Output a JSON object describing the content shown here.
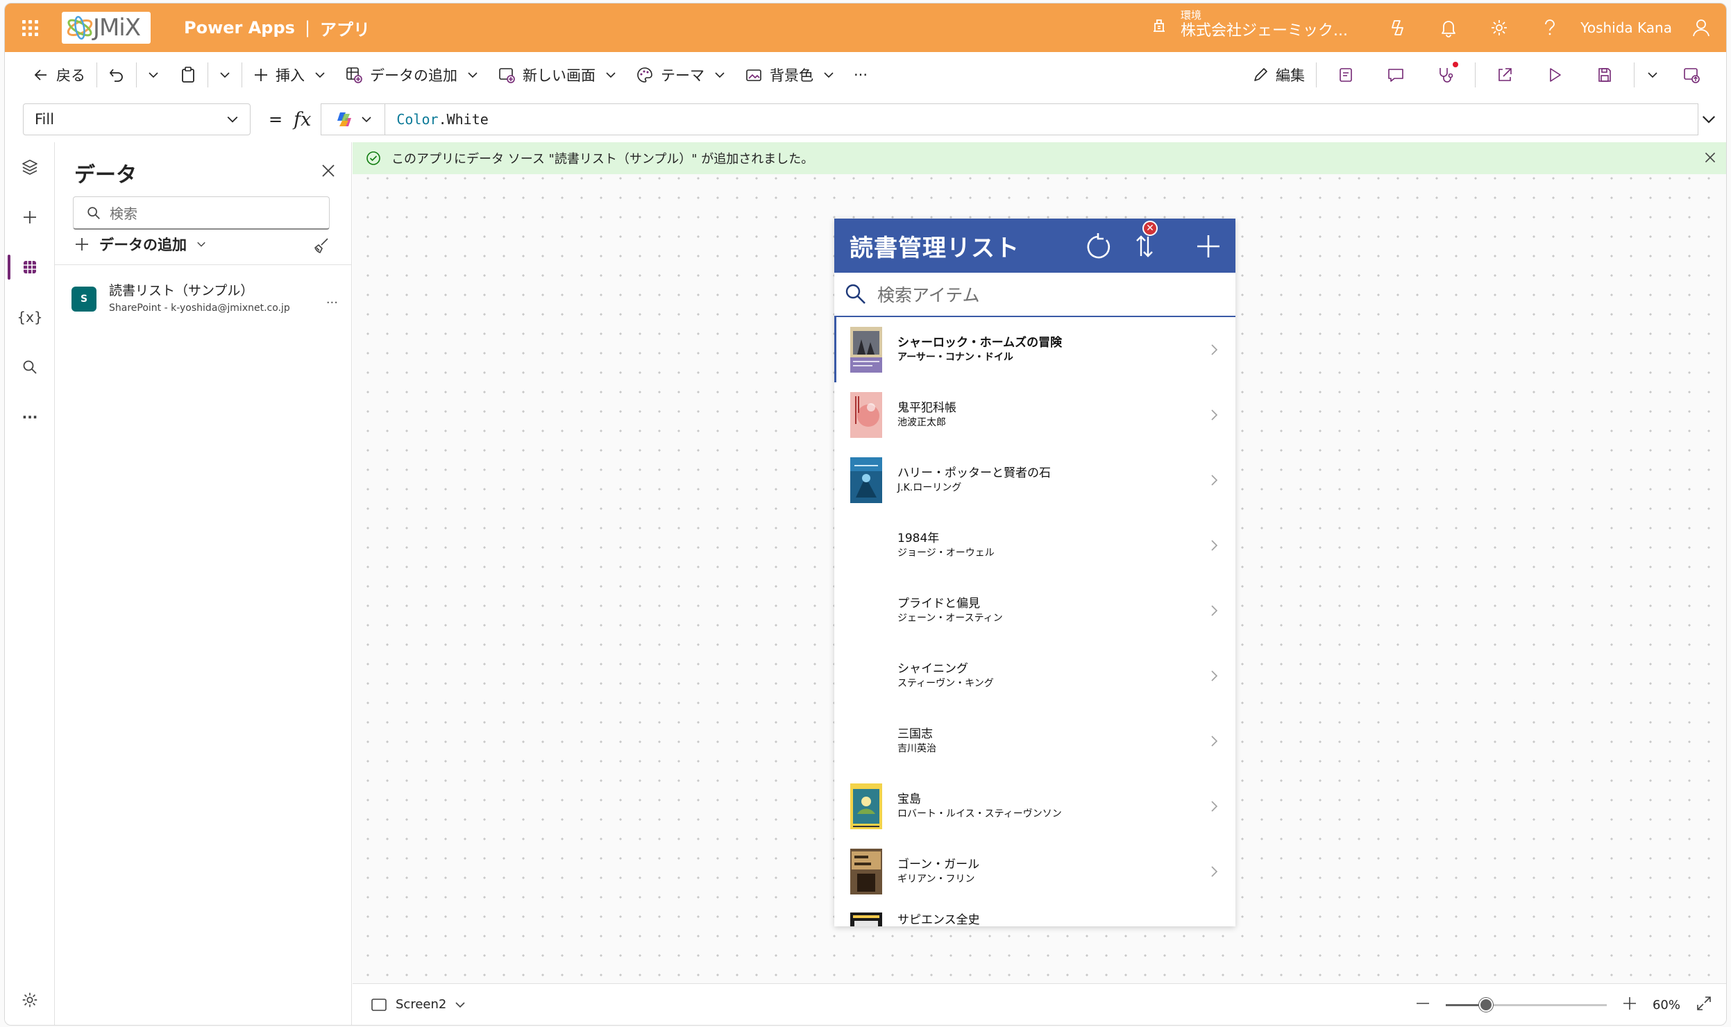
{
  "header": {
    "brand": "JMiX",
    "product": "Power Apps",
    "separator": "|",
    "section": "アプリ",
    "env_label": "環境",
    "env_name": "株式会社ジェーミック...",
    "user_name": "Yoshida Kana",
    "bg_color": "#f5a04a"
  },
  "commandbar": {
    "back": "戻る",
    "insert": "挿入",
    "add_data": "データの追加",
    "new_screen": "新しい画面",
    "theme": "テーマ",
    "background": "背景色",
    "more": "···",
    "edit": "編集"
  },
  "formula": {
    "property": "Fill",
    "equals": "=",
    "fx": "fx",
    "ns": "Color",
    "value": ".White"
  },
  "rail": {
    "variables": "{x}",
    "more": "···"
  },
  "data_panel": {
    "title": "データ",
    "search_placeholder": "検索",
    "add_data": "データの追加",
    "sources": [
      {
        "name": "読書リスト（サンプル）",
        "sub": "SharePoint - k-yoshida@jmixnet.co.jp",
        "more": "..."
      }
    ]
  },
  "banner": {
    "message": "このアプリにデータ ソース \"読書リスト（サンプル）\" が追加されました。"
  },
  "app": {
    "title": "読書管理リスト",
    "search_placeholder": "検索アイテム",
    "error_badge": "✕",
    "accent": "#3a5aa6",
    "items": [
      {
        "title": "シャーロック・ホームズの冒険",
        "author": "アーサー・コナン・ドイル",
        "cover": "sherlock"
      },
      {
        "title": "鬼平犯科帳",
        "author": "池波正太郎",
        "cover": "onihei"
      },
      {
        "title": "ハリー・ポッターと賢者の石",
        "author": "J.K.ローリング",
        "cover": "harry"
      },
      {
        "title": "1984年",
        "author": "ジョージ・オーウェル",
        "cover": ""
      },
      {
        "title": "プライドと偏見",
        "author": "ジェーン・オースティン",
        "cover": ""
      },
      {
        "title": "シャイニング",
        "author": "スティーヴン・キング",
        "cover": ""
      },
      {
        "title": "三国志",
        "author": "吉川英治",
        "cover": ""
      },
      {
        "title": "宝島",
        "author": "ロバート・ルイス・スティーヴンソン",
        "cover": "treasure"
      },
      {
        "title": "ゴーン・ガール",
        "author": "ギリアン・フリン",
        "cover": "gonegirl"
      },
      {
        "title": "サピエンス全史",
        "author": "",
        "cover": "sapiens"
      }
    ]
  },
  "statusbar": {
    "screen": "Screen2",
    "zoom": "60%",
    "zoom_level": 0.6
  }
}
